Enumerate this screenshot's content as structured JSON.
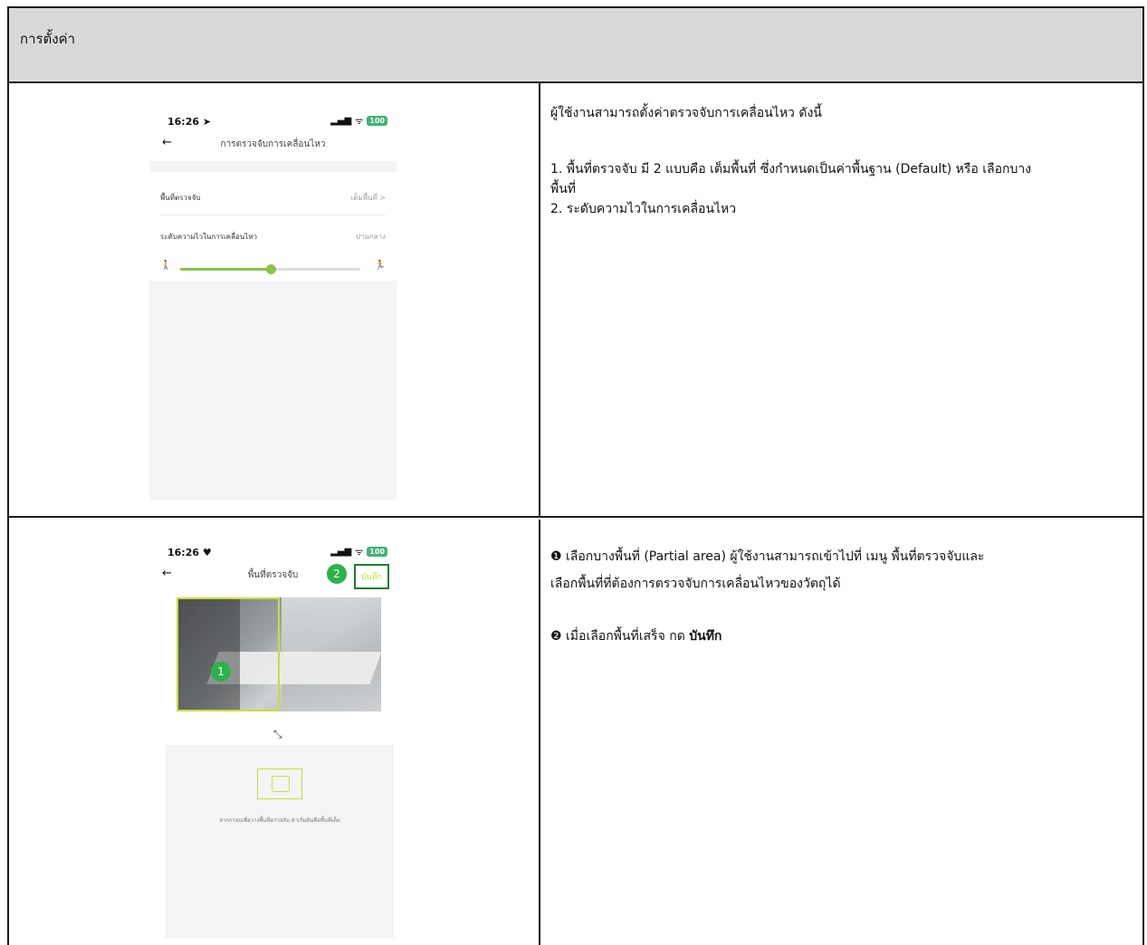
{
  "header": {
    "title": "การตั้งค่า"
  },
  "row1": {
    "phone": {
      "time": "16:26 ➤",
      "signal": "▂▄▆",
      "wifi": "ᯤ",
      "battery": "100",
      "back": "←",
      "title": "การตรวจจับการเคลื่อนไหว",
      "detection_area_label": "พื้นที่ตรวจจับ",
      "detection_area_value": "เต็มพื้นที่ >",
      "sensitivity_label": "ระดับความไวในการเคลื่อนไหว",
      "sensitivity_value": "ปานกลาง",
      "sensitivity_level": 0.5
    },
    "description": {
      "intro": "ผู้ใช้งานสามารถตั้งค่าตรวจจับการเคลื่อนไหว ดังนี้",
      "item1": "1. พื้นที่ตรวจจับ มี 2 แบบคือ เต็มพื้นที่ ซึ่งกำหนดเป็นค่าพื้นฐาน (Default) หรือ เลือกบาง",
      "item1_cont": "พื้นที่",
      "item2": "2. ระดับความไวในการเคลื่อนไหว"
    }
  },
  "row2": {
    "phone": {
      "time": "16:26 ♥",
      "signal": "▂▄▆",
      "wifi": "ᯤ",
      "battery": "100",
      "back": "←",
      "title": "พื้นที่ตรวจจับ",
      "save_label": "บันทึก",
      "badge1": "1",
      "badge2": "2",
      "resize": "⤡",
      "area_hint": "ลากกรอบเพื่อวางพื้นที่ตรวจจับ ค่าเริ่มต้นคือพื้นที่เต็ม"
    },
    "description": {
      "step1_bullet": "❶",
      "step1_line1": "เลือกบางพื้นที่ (Partial area) ผู้ใช้งานสามารถเข้าไปที่ เมนู พื้นที่ตรวจจับและ",
      "step1_line2": "เลือกพื้นที่ที่ต้องการตรวจจับการเคลื่อนไหวของวัตถุได้",
      "step2_bullet": "❷",
      "step2_text": "เมื่อเลือกพื้นที่เสร็จ กด",
      "step2_bold": "บันทึก"
    }
  },
  "colors": {
    "accent_green": "#2bb34a",
    "slider_green": "#8bc34a",
    "highlight_lime": "#cddc39",
    "header_gray": "#d9d9d9"
  },
  "icons": {
    "back": "back-arrow-icon",
    "signal": "signal-icon",
    "wifi": "wifi-icon",
    "battery": "battery-icon",
    "resize": "resize-icon"
  }
}
